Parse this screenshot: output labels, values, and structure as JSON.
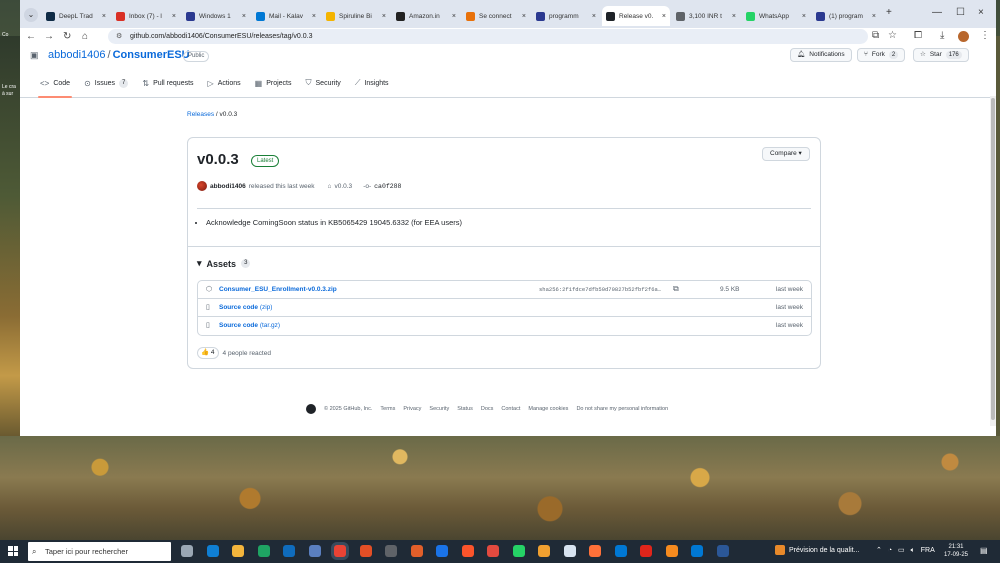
{
  "browser": {
    "tabs": [
      {
        "label": "DeepL Trad",
        "color": "#0f2b46",
        "active": false
      },
      {
        "label": "Inbox (7) - l",
        "color": "#d93025",
        "active": false
      },
      {
        "label": "Windows 1",
        "color": "#2b3990",
        "active": false
      },
      {
        "label": "Mail - Kalav",
        "color": "#0078d4",
        "active": false
      },
      {
        "label": "Spiruline Bi",
        "color": "#f4b400",
        "active": false
      },
      {
        "label": "Amazon.in",
        "color": "#222222",
        "active": false
      },
      {
        "label": "Se connect",
        "color": "#e8710a",
        "active": false
      },
      {
        "label": "programm",
        "color": "#2b3990",
        "active": false
      },
      {
        "label": "Release v0.",
        "color": "#1f2328",
        "active": true
      },
      {
        "label": "3,100 INR t",
        "color": "#5f6368",
        "active": false
      },
      {
        "label": "WhatsApp",
        "color": "#25d366",
        "active": false
      },
      {
        "label": "(1) program",
        "color": "#2b3990",
        "active": false
      }
    ],
    "url": "github.com/abbodi1406/ConsumerESU/releases/tag/v0.0.3",
    "new_tab": "+",
    "close": "×"
  },
  "repo": {
    "owner": "abbodi1406",
    "separator": "/",
    "name": "ConsumerESU",
    "visibility": "Public",
    "notifications": "Notifications",
    "fork_label": "Fork",
    "fork_count": "2",
    "star_label": "Star",
    "star_count": "176"
  },
  "nav_tabs": [
    {
      "label": "Code",
      "icon": "<>",
      "count": null,
      "active": true
    },
    {
      "label": "Issues",
      "icon": "⊙",
      "count": "7",
      "active": false
    },
    {
      "label": "Pull requests",
      "icon": "⇅",
      "count": null,
      "active": false
    },
    {
      "label": "Actions",
      "icon": "▷",
      "count": null,
      "active": false
    },
    {
      "label": "Projects",
      "icon": "▦",
      "count": null,
      "active": false
    },
    {
      "label": "Security",
      "icon": "⛉",
      "count": null,
      "active": false
    },
    {
      "label": "Insights",
      "icon": "⟋",
      "count": null,
      "active": false
    }
  ],
  "breadcrumb": {
    "releases": "Releases",
    "sep": "/",
    "current": "v0.0.3"
  },
  "release": {
    "title": "v0.0.3",
    "badge": "Latest",
    "compare": "Compare",
    "author": "abbodi1406",
    "released": "released this last week",
    "tag": "v0.0.3",
    "commit": "ca0f288",
    "notes": [
      "Acknowledge ComingSoon status in KB5065429 19045.6332 (for EEA users)"
    ],
    "assets_label": "Assets",
    "assets_count": "3",
    "assets": [
      {
        "name": "Consumer_ESU_Enrollment-v0.0.3.zip",
        "sub": "",
        "sha": "sha256:2f1fdce7dfb50d70827b52fbf2f6a…",
        "size": "9.5 KB",
        "date": "last week",
        "icon": "cube-icon"
      },
      {
        "name": "Source code",
        "sub": "(zip)",
        "sha": "",
        "size": "",
        "date": "last week",
        "icon": "file-zip-icon"
      },
      {
        "name": "Source code",
        "sub": "(tar.gz)",
        "sha": "",
        "size": "",
        "date": "last week",
        "icon": "file-zip-icon"
      }
    ],
    "reaction_emoji": "👍",
    "reaction_count": "4",
    "reaction_text": "4 people reacted"
  },
  "footer": {
    "copyright": "© 2025 GitHub, Inc.",
    "links": [
      "Terms",
      "Privacy",
      "Security",
      "Status",
      "Docs",
      "Contact",
      "Manage cookies",
      "Do not share my personal information"
    ]
  },
  "desktop": {
    "line1": "Le cra",
    "line2": "à sur",
    "top": "Co"
  },
  "taskbar": {
    "search_placeholder": "Taper ici pour rechercher",
    "weather": "Prévision de la qualit...",
    "lang": "FRA",
    "time": "21:31",
    "date": "17-09-25"
  }
}
